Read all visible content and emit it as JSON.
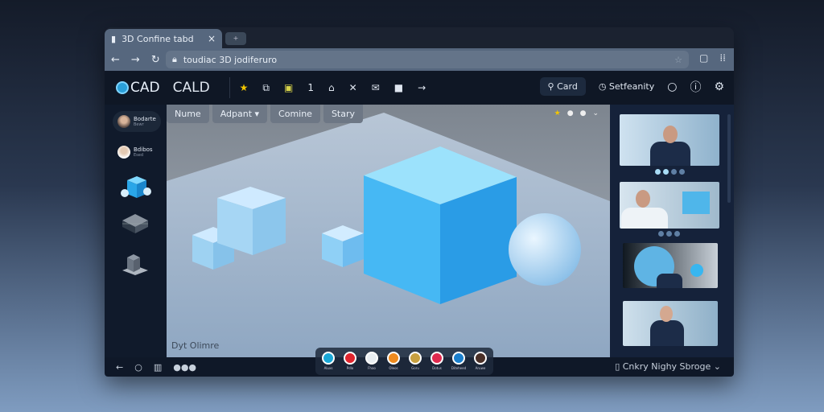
{
  "browser": {
    "tab_title": "3D Confine tabd",
    "tab_close": "×",
    "new_tab": "+",
    "url": "toudiac 3D jodiferuro",
    "back": "←",
    "forward": "→",
    "reload": "↻"
  },
  "app": {
    "logo": "CAD",
    "brand": "CALD",
    "toolbar": [
      "★",
      "⧉",
      "▣",
      "1",
      "⌂",
      "✕",
      "✉",
      "■",
      "→"
    ],
    "search_label": "Card",
    "security_label": "Setfeanity"
  },
  "sidebar": {
    "users": [
      {
        "name": "Bodarte",
        "sub": "Bewr"
      },
      {
        "name": "Bdibos",
        "sub": "Esed"
      }
    ]
  },
  "viewport": {
    "tabs": [
      "Nume",
      "Adpant ▾",
      "Comine",
      "Stary"
    ],
    "label": "Dyt Olimre",
    "top_icons": [
      "★",
      "●",
      "●",
      "⌄"
    ]
  },
  "dock": {
    "apps": [
      {
        "label": "Aluxs",
        "color": "#1aa7d6"
      },
      {
        "label": "Pdlo",
        "color": "#e0252e"
      },
      {
        "label": "Fhoo",
        "color": "#e9eef2"
      },
      {
        "label": "Oleos",
        "color": "#ef8a1e"
      },
      {
        "label": "Goru",
        "color": "#c8a040"
      },
      {
        "label": "Dotus",
        "color": "#e0294e"
      },
      {
        "label": "Diteheed",
        "color": "#1b7fcc"
      },
      {
        "label": "Aruwe",
        "color": "#4a3028"
      }
    ]
  },
  "bottom": {
    "storage": "Cnkry Nighy Sbroge ⌄"
  },
  "colors": {
    "accent": "#35b8f0",
    "header": "#0f1725",
    "panel": "#15223a"
  }
}
